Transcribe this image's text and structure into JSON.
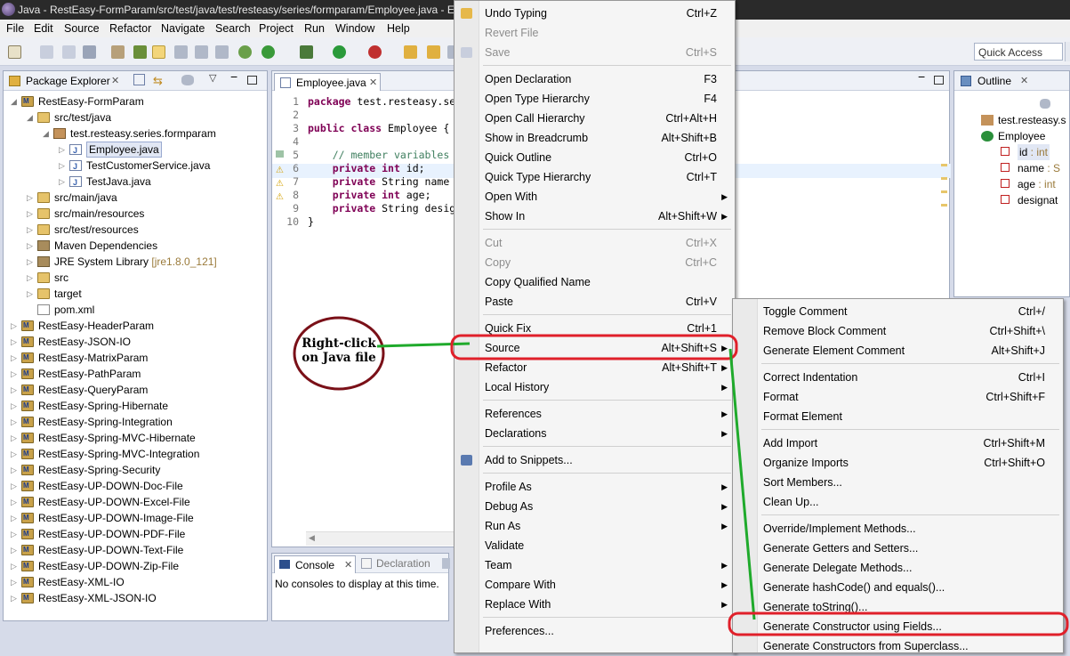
{
  "window": {
    "title": "Java - RestEasy-FormParam/src/test/java/test/resteasy/series/formparam/Employee.java - Ec"
  },
  "menubar": [
    "File",
    "Edit",
    "Source",
    "Refactor",
    "Navigate",
    "Search",
    "Project",
    "Run",
    "Window",
    "Help"
  ],
  "quick_access": "Quick Access",
  "package_explorer": {
    "title": "Package Explorer",
    "items": [
      {
        "label": "RestEasy-FormParam",
        "level": 0,
        "expanded": true,
        "icon": "project"
      },
      {
        "label": "src/test/java",
        "level": 1,
        "expanded": true,
        "icon": "source-folder"
      },
      {
        "label": "test.resteasy.series.formparam",
        "level": 2,
        "expanded": true,
        "icon": "package"
      },
      {
        "label": "Employee.java",
        "level": 3,
        "expanded": false,
        "icon": "java-file",
        "selected": true
      },
      {
        "label": "TestCustomerService.java",
        "level": 3,
        "expanded": false,
        "icon": "java-file"
      },
      {
        "label": "TestJava.java",
        "level": 3,
        "expanded": false,
        "icon": "java-file"
      },
      {
        "label": "src/main/java",
        "level": 1,
        "expanded": false,
        "icon": "source-folder"
      },
      {
        "label": "src/main/resources",
        "level": 1,
        "expanded": false,
        "icon": "source-folder"
      },
      {
        "label": "src/test/resources",
        "level": 1,
        "expanded": false,
        "icon": "source-folder"
      },
      {
        "label": "Maven Dependencies",
        "level": 1,
        "expanded": false,
        "icon": "library"
      },
      {
        "label": "JRE System Library",
        "suffix": "[jre1.8.0_121]",
        "level": 1,
        "expanded": false,
        "icon": "library"
      },
      {
        "label": "src",
        "level": 1,
        "expanded": false,
        "icon": "folder"
      },
      {
        "label": "target",
        "level": 1,
        "expanded": false,
        "icon": "folder"
      },
      {
        "label": "pom.xml",
        "level": 1,
        "expanded": false,
        "icon": "xml-file"
      },
      {
        "label": "RestEasy-HeaderParam",
        "level": 0,
        "icon": "project"
      },
      {
        "label": "RestEasy-JSON-IO",
        "level": 0,
        "icon": "project"
      },
      {
        "label": "RestEasy-MatrixParam",
        "level": 0,
        "icon": "project"
      },
      {
        "label": "RestEasy-PathParam",
        "level": 0,
        "icon": "project"
      },
      {
        "label": "RestEasy-QueryParam",
        "level": 0,
        "icon": "project"
      },
      {
        "label": "RestEasy-Spring-Hibernate",
        "level": 0,
        "icon": "project"
      },
      {
        "label": "RestEasy-Spring-Integration",
        "level": 0,
        "icon": "project"
      },
      {
        "label": "RestEasy-Spring-MVC-Hibernate",
        "level": 0,
        "icon": "project"
      },
      {
        "label": "RestEasy-Spring-MVC-Integration",
        "level": 0,
        "icon": "project"
      },
      {
        "label": "RestEasy-Spring-Security",
        "level": 0,
        "icon": "project"
      },
      {
        "label": "RestEasy-UP-DOWN-Doc-File",
        "level": 0,
        "icon": "project"
      },
      {
        "label": "RestEasy-UP-DOWN-Excel-File",
        "level": 0,
        "icon": "project"
      },
      {
        "label": "RestEasy-UP-DOWN-Image-File",
        "level": 0,
        "icon": "project"
      },
      {
        "label": "RestEasy-UP-DOWN-PDF-File",
        "level": 0,
        "icon": "project"
      },
      {
        "label": "RestEasy-UP-DOWN-Text-File",
        "level": 0,
        "icon": "project"
      },
      {
        "label": "RestEasy-UP-DOWN-Zip-File",
        "level": 0,
        "icon": "project"
      },
      {
        "label": "RestEasy-XML-IO",
        "level": 0,
        "icon": "project"
      },
      {
        "label": "RestEasy-XML-JSON-IO",
        "level": 0,
        "icon": "project"
      }
    ]
  },
  "editor": {
    "tab": "Employee.java",
    "lines": [
      {
        "n": "1",
        "html": "<span class='kw'>package</span> test.resteasy.se"
      },
      {
        "n": "2",
        "html": ""
      },
      {
        "n": "3",
        "html": "<span class='kw'>public class</span> Employee {"
      },
      {
        "n": "4",
        "html": ""
      },
      {
        "n": "5",
        "html": "    <span class='cm'>// member variables</span>"
      },
      {
        "n": "6",
        "html": "    <span class='kw'>private int</span> id;"
      },
      {
        "n": "7",
        "html": "    <span class='kw'>private</span> String name"
      },
      {
        "n": "8",
        "html": "    <span class='kw'>private int</span> age;"
      },
      {
        "n": "9",
        "html": "    <span class='kw'>private</span> String desig"
      },
      {
        "n": "10",
        "html": "}"
      }
    ]
  },
  "console": {
    "tab_console": "Console",
    "tab_declaration": "Declaration",
    "message": "No consoles to display at this time."
  },
  "outline": {
    "title": "Outline",
    "items": [
      {
        "label": "test.resteasy.s",
        "level": 0
      },
      {
        "label": "Employee",
        "level": 0
      },
      {
        "label": "id : int",
        "level": 1,
        "selected": true
      },
      {
        "label": "name : S",
        "level": 1
      },
      {
        "label": "age : int",
        "level": 1
      },
      {
        "label": "designat",
        "level": 1
      }
    ]
  },
  "context_menu": {
    "items": [
      {
        "label": "Undo Typing",
        "shortcut": "Ctrl+Z",
        "icon": "undo-icon"
      },
      {
        "label": "Revert File",
        "disabled": true
      },
      {
        "label": "Save",
        "shortcut": "Ctrl+S",
        "disabled": true,
        "icon": "save-icon"
      },
      {
        "sep": true
      },
      {
        "label": "Open Declaration",
        "shortcut": "F3"
      },
      {
        "label": "Open Type Hierarchy",
        "shortcut": "F4"
      },
      {
        "label": "Open Call Hierarchy",
        "shortcut": "Ctrl+Alt+H"
      },
      {
        "label": "Show in Breadcrumb",
        "shortcut": "Alt+Shift+B"
      },
      {
        "label": "Quick Outline",
        "shortcut": "Ctrl+O"
      },
      {
        "label": "Quick Type Hierarchy",
        "shortcut": "Ctrl+T"
      },
      {
        "label": "Open With",
        "submenu": true
      },
      {
        "label": "Show In",
        "shortcut": "Alt+Shift+W",
        "submenu": true
      },
      {
        "sep": true
      },
      {
        "label": "Cut",
        "shortcut": "Ctrl+X",
        "disabled": true
      },
      {
        "label": "Copy",
        "shortcut": "Ctrl+C",
        "disabled": true
      },
      {
        "label": "Copy Qualified Name"
      },
      {
        "label": "Paste",
        "shortcut": "Ctrl+V"
      },
      {
        "sep": true
      },
      {
        "label": "Quick Fix",
        "shortcut": "Ctrl+1"
      },
      {
        "label": "Source",
        "shortcut": "Alt+Shift+S",
        "submenu": true,
        "highlight": true
      },
      {
        "label": "Refactor",
        "shortcut": "Alt+Shift+T",
        "submenu": true
      },
      {
        "label": "Local History",
        "submenu": true
      },
      {
        "sep": true
      },
      {
        "label": "References",
        "submenu": true
      },
      {
        "label": "Declarations",
        "submenu": true
      },
      {
        "sep": true
      },
      {
        "label": "Add to Snippets...",
        "icon": "snippet-icon"
      },
      {
        "sep": true
      },
      {
        "label": "Profile As",
        "submenu": true
      },
      {
        "label": "Debug As",
        "submenu": true
      },
      {
        "label": "Run As",
        "submenu": true
      },
      {
        "label": "Validate"
      },
      {
        "label": "Team",
        "submenu": true
      },
      {
        "label": "Compare With",
        "submenu": true
      },
      {
        "label": "Replace With",
        "submenu": true
      },
      {
        "sep": true
      },
      {
        "label": "Preferences..."
      }
    ]
  },
  "source_submenu": {
    "items": [
      {
        "label": "Toggle Comment",
        "shortcut": "Ctrl+/"
      },
      {
        "label": "Remove Block Comment",
        "shortcut": "Ctrl+Shift+\\"
      },
      {
        "label": "Generate Element Comment",
        "shortcut": "Alt+Shift+J"
      },
      {
        "sep": true
      },
      {
        "label": "Correct Indentation",
        "shortcut": "Ctrl+I"
      },
      {
        "label": "Format",
        "shortcut": "Ctrl+Shift+F"
      },
      {
        "label": "Format Element"
      },
      {
        "sep": true
      },
      {
        "label": "Add Import",
        "shortcut": "Ctrl+Shift+M"
      },
      {
        "label": "Organize Imports",
        "shortcut": "Ctrl+Shift+O"
      },
      {
        "label": "Sort Members..."
      },
      {
        "label": "Clean Up..."
      },
      {
        "sep": true
      },
      {
        "label": "Override/Implement Methods..."
      },
      {
        "label": "Generate Getters and Setters..."
      },
      {
        "label": "Generate Delegate Methods..."
      },
      {
        "label": "Generate hashCode() and equals()..."
      },
      {
        "label": "Generate toString()..."
      },
      {
        "label": "Generate Constructor using Fields...",
        "highlight": true
      },
      {
        "label": "Generate Constructors from Superclass..."
      }
    ]
  },
  "annotation": {
    "text_line1": "Right-click",
    "text_line2": "on Java file",
    "circle_color": "#7a1018",
    "arrow_color": "#1faa2b",
    "highlight_color": "#e0202a"
  }
}
